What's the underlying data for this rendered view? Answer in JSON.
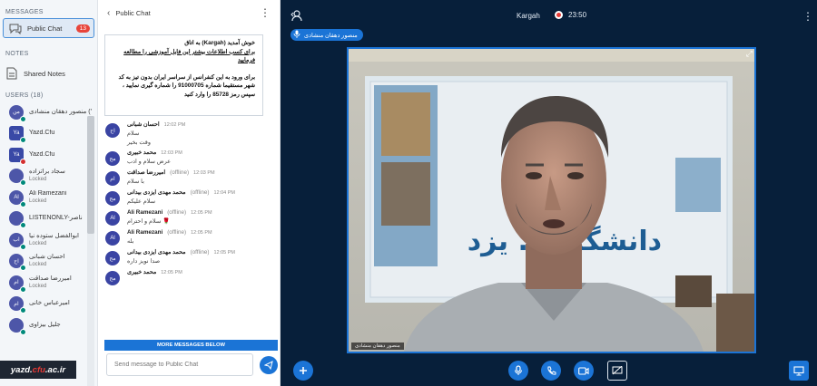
{
  "sidebar": {
    "messages_heading": "MESSAGES",
    "public_chat_label": "Public Chat",
    "public_chat_badge": "13",
    "notes_heading": "NOTES",
    "shared_notes_label": "Shared Notes",
    "users_heading": "USERS (18)",
    "users": [
      {
        "avatar": "من",
        "name": "منصور دهقان منشادی (You)",
        "status": "",
        "dot": "green",
        "shape": "round"
      },
      {
        "avatar": "Ya",
        "name": "Yazd.Cfu",
        "status": "",
        "dot": "green",
        "shape": "square"
      },
      {
        "avatar": "Ya",
        "name": "Yazd.Cfu",
        "status": "",
        "dot": "red",
        "shape": "square"
      },
      {
        "avatar": "",
        "name": "سجاد براتزاده",
        "status": "Locked",
        "dot": "green",
        "shape": "round"
      },
      {
        "avatar": "Al",
        "name": "Ali Ramezani",
        "status": "Locked",
        "dot": "green",
        "shape": "round"
      },
      {
        "avatar": "",
        "name": "LISTENONLY-ناصر",
        "status": "",
        "dot": "green",
        "shape": "round"
      },
      {
        "avatar": "اب",
        "name": "ابوالفضل ستوده نیا",
        "status": "Locked",
        "dot": "green",
        "shape": "round"
      },
      {
        "avatar": "اح",
        "name": "احسان شبانی",
        "status": "Locked",
        "dot": "green",
        "shape": "round"
      },
      {
        "avatar": "ام",
        "name": "امیررضا صداقت",
        "status": "Locked",
        "dot": "green",
        "shape": "round"
      },
      {
        "avatar": "ام",
        "name": "امیرعباس خانی",
        "status": "",
        "dot": "green",
        "shape": "round"
      },
      {
        "avatar": "",
        "name": "جلیل بیزاوی",
        "status": "",
        "dot": "green",
        "shape": "round"
      }
    ],
    "logo_text_a": "yazd.",
    "logo_text_b": "cfu",
    "logo_text_c": ".ac.ir"
  },
  "chat": {
    "title": "Public Chat",
    "welcome_lines": [
      "خوش آمدید (Kargah) به اتاق",
      "برای کسب اطلاعات بیشتر این فایل آموزشی را مطالعه فرمایید",
      "",
      "برای ورود به این کنفرانس از سراسر ایران بدون تیز به کد",
      "شهر مستقیما شماره 91000705 را شماره گیری نمایید ،",
      "سپس رمز 85728 را وارد کنید"
    ],
    "messages": [
      {
        "avatar": "اح",
        "name": "احسان شبانی",
        "offline": "",
        "time": "12:02 PM",
        "texts": [
          "سلام",
          "وقت بخیر"
        ]
      },
      {
        "avatar": "مح",
        "name": "محمد خبیری",
        "offline": "",
        "time": "12:03 PM",
        "texts": [
          "عرض سلام و ادب"
        ]
      },
      {
        "avatar": "ام",
        "name": "امیررضا صداقت",
        "offline": "(offline)",
        "time": "12:03 PM",
        "texts": [
          "با سلام"
        ]
      },
      {
        "avatar": "مح",
        "name": "محمد مهدی ایزدی بیدانی",
        "offline": "(offline)",
        "time": "12:04 PM",
        "texts": [
          "سلام علیکم"
        ]
      },
      {
        "avatar": "Al",
        "name": "Ali Ramezani",
        "offline": "(offline)",
        "time": "12:05 PM",
        "texts": [
          "سلام و احترام 🌹"
        ]
      },
      {
        "avatar": "Al",
        "name": "Ali Ramezani",
        "offline": "(offline)",
        "time": "12:05 PM",
        "texts": [
          "بله"
        ]
      },
      {
        "avatar": "مح",
        "name": "محمد مهدی ایزدی بیدانی",
        "offline": "(offline)",
        "time": "12:05 PM",
        "texts": [
          "صدا نویز داره"
        ]
      },
      {
        "avatar": "مح",
        "name": "محمد خبیری",
        "offline": "",
        "time": "12:05 PM",
        "texts": [
          ""
        ]
      }
    ],
    "more_below_label": "MORE MESSAGES BELOW",
    "input_placeholder": "Send message to Public Chat"
  },
  "stage": {
    "meeting_name": "Kargah",
    "recording_time": "23:50",
    "talking_user": "منصور دهقان منشادی",
    "video_label": "منصور دهقان منشادی",
    "banner_text": "دانشگاه ... یزد"
  },
  "colors": {
    "primary": "#1b74d6",
    "stage_bg": "#071f3a",
    "badge": "#e8443a"
  },
  "icons": {
    "users_toggle": "user-icon",
    "more": "kebab-icon",
    "actions": "plus-icon",
    "mic": "microphone-icon",
    "phone": "phone-icon",
    "camera": "video-camera-icon",
    "screenshare": "screenshare-off-icon",
    "presentation": "presentation-icon"
  }
}
